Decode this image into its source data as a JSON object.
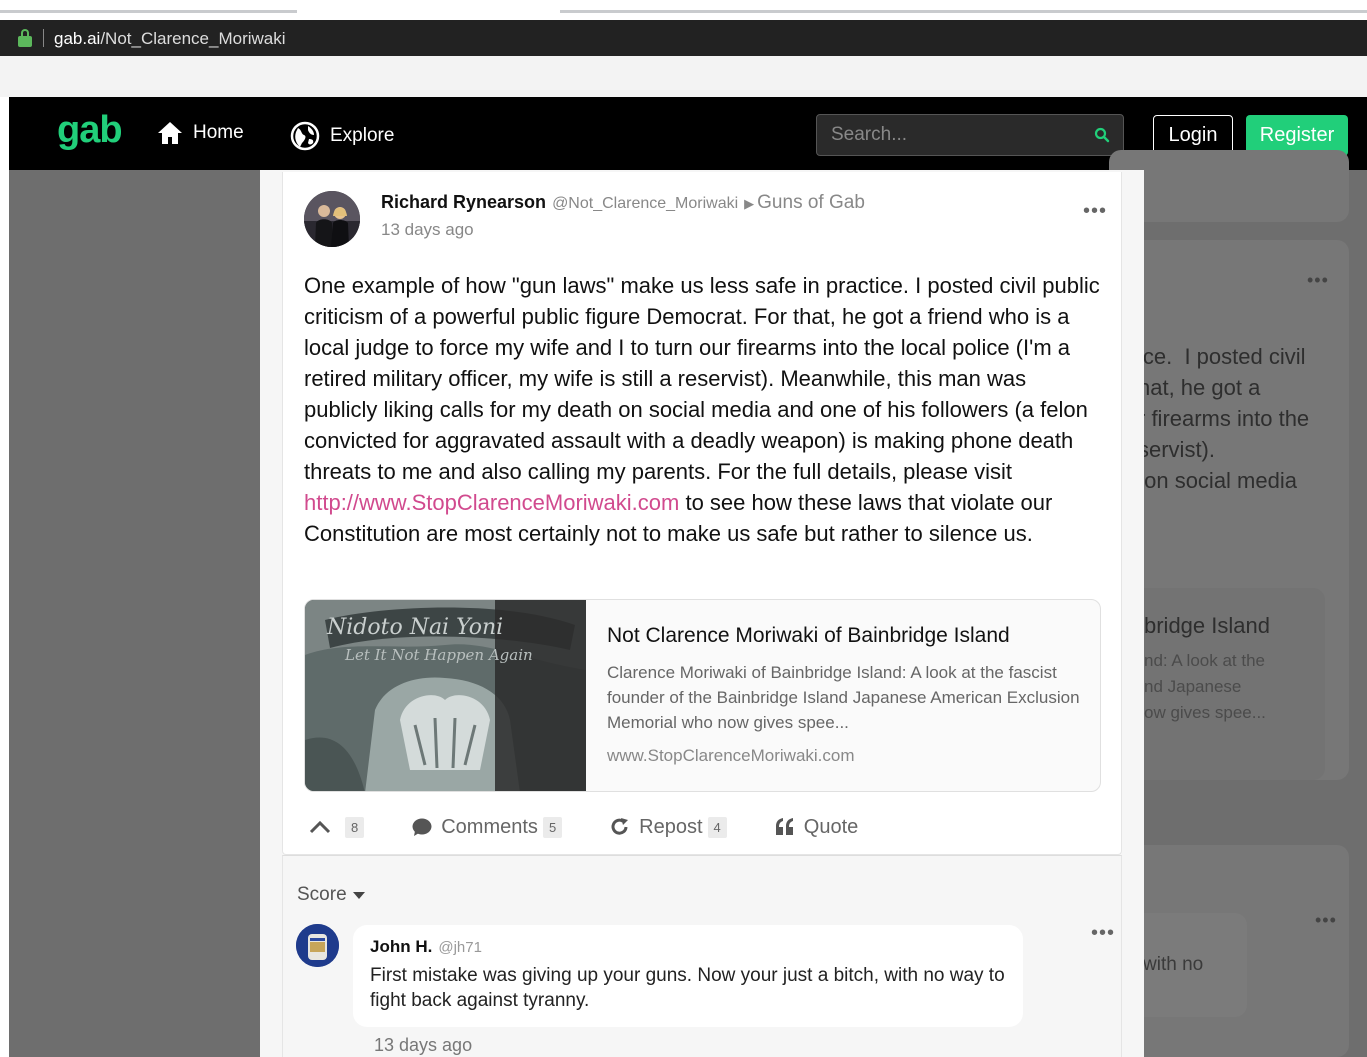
{
  "browser": {
    "url_host": "gab.ai",
    "url_path": "/Not_Clarence_Moriwaki"
  },
  "nav": {
    "logo": "gab",
    "home_label": "Home",
    "explore_label": "Explore",
    "search_placeholder": "Search...",
    "login_label": "Login",
    "register_label": "Register",
    "brand_color": "#21cf7a"
  },
  "post": {
    "author_name": "Richard Rynearson",
    "author_handle": "@Not_Clarence_Moriwaki",
    "group": "Guns of Gab",
    "time": "13 days ago",
    "body_before_link": "One example of how \"gun laws\" make us less safe in practice.  I posted civil public criticism of a powerful public figure Democrat.  For that, he got a friend who is a local judge to force my wife and I to turn our firearms into the local police (I'm a retired military officer, my wife is still a reservist).  Meanwhile, this man was publicly liking calls for my death on social media and one of his followers (a felon convicted for aggravated assault with a deadly weapon) is making phone death threats to me and also calling my parents.  For the full details, please visit ",
    "body_link": "http://www.StopClarenceMoriwaki.com",
    "body_after_link": " to see how these laws that violate our Constitution are most certainly not to make us safe but rather to silence us.",
    "link_color": "#d14a8e",
    "link_card": {
      "image_text_1": "Nidoto Nai Yoni",
      "image_text_2": "Let It Not Happen Again",
      "title": "Not Clarence Moriwaki of Bainbridge Island",
      "description": "Clarence Moriwaki of Bainbridge Island: A look at the fascist founder of the Bainbridge Island Japanese American Exclusion Memorial who now gives spee...",
      "domain": "www.StopClarenceMoriwaki.com"
    },
    "actions": {
      "upvote_count": "8",
      "comments_label": "Comments",
      "comments_count": "5",
      "repost_label": "Repost",
      "repost_count": "4",
      "quote_label": "Quote"
    }
  },
  "comments": {
    "sort_label": "Score",
    "items": [
      {
        "author_name": "John H.",
        "author_handle": "@jh71",
        "text": "First mistake was giving up your guns. Now your just a bitch, with no way to fight back against tyranny.",
        "time": "13 days ago"
      }
    ]
  },
  "background": {
    "text_lines": "ice.  I posted civil\nhat, he got a\nr firearms into the\nservist).\n on social media",
    "card_title": "bridge Island",
    "card_desc": "nd: A look at the\nnd Japanese\now gives spee...",
    "comment_fragment": "with no"
  }
}
